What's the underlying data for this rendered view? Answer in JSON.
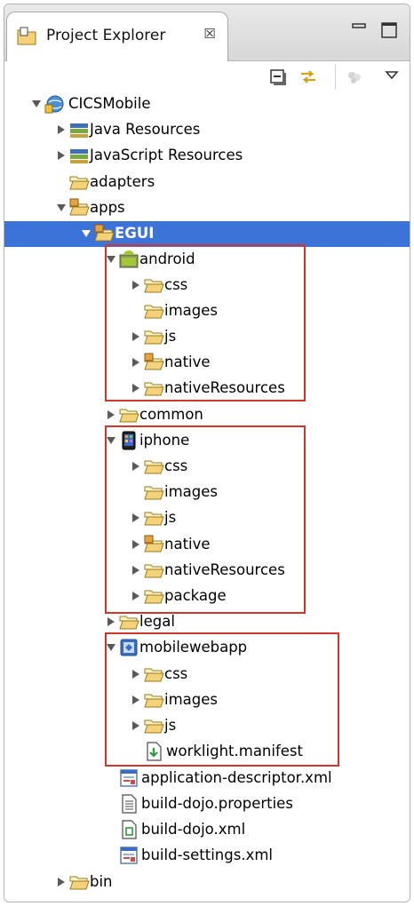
{
  "view": {
    "tab_title": "Project Explorer",
    "tab_close_glyph": "☒",
    "minimize_icon": "minimize-icon",
    "maximize_icon": "maximize-icon"
  },
  "toolbar": {
    "collapse_all_icon": "collapse-all-icon",
    "link_editor_icon": "link-with-editor-icon",
    "disabled_icon": "disabled-filter-icon",
    "view_menu_icon": "view-menu-icon"
  },
  "tree": {
    "root": "CICSMobile",
    "java_resources": "Java Resources",
    "javascript_resources": "JavaScript Resources",
    "adapters": "adapters",
    "apps": "apps",
    "egui": "EGUI",
    "android": {
      "label": "android",
      "css": "css",
      "images": "images",
      "js": "js",
      "native": "native",
      "native_resources": "nativeResources"
    },
    "common": "common",
    "iphone": {
      "label": "iphone",
      "css": "css",
      "images": "images",
      "js": "js",
      "native": "native",
      "native_resources": "nativeResources",
      "package": "package"
    },
    "legal": "legal",
    "mobilewebapp": {
      "label": "mobilewebapp",
      "css": "css",
      "images": "images",
      "js": "js",
      "manifest": "worklight.manifest"
    },
    "application_descriptor": "application-descriptor.xml",
    "build_dojo_properties": "build-dojo.properties",
    "build_dojo_xml": "build-dojo.xml",
    "build_settings": "build-settings.xml",
    "bin": "bin"
  },
  "colors": {
    "selection": "#3c73d9",
    "highlight_box": "#d1362b",
    "folder": "#f4d27a"
  }
}
